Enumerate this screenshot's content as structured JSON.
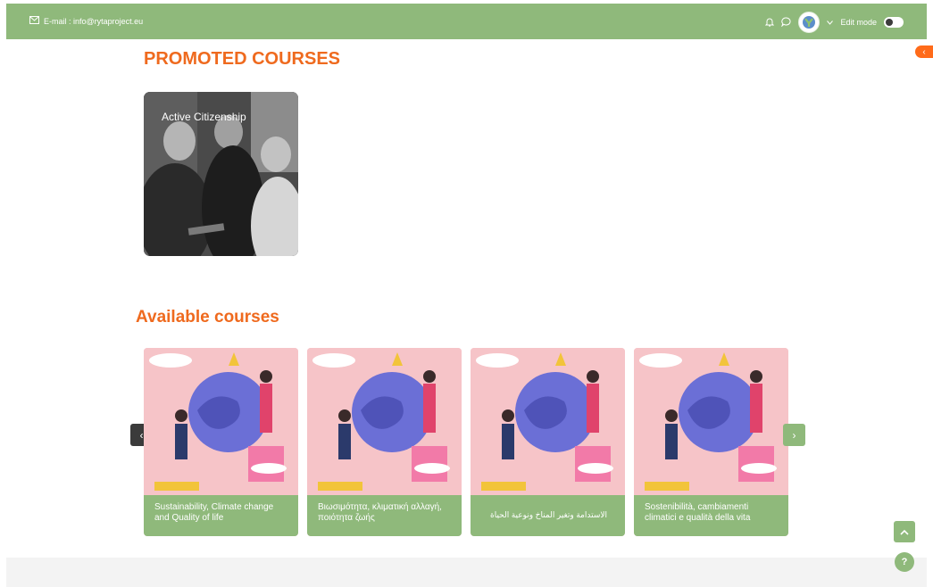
{
  "topbar": {
    "email_text": "E-mail : info@rytaproject.eu",
    "edit_mode_label": "Edit mode"
  },
  "promoted": {
    "heading": "PROMOTED COURSES",
    "courses": [
      {
        "title": "Active Citizenship"
      }
    ]
  },
  "available": {
    "heading": "Available courses",
    "courses": [
      {
        "title": "Sustainability, Climate change and Quality of life"
      },
      {
        "title": "Βιωσιμότητα, κλιματική αλλαγή, ποιότητα ζωής"
      },
      {
        "title": "الاستدامة وتغير المناخ ونوعية الحياة"
      },
      {
        "title": "Sostenibilità, cambiamenti climatici e qualità della vita"
      }
    ]
  },
  "controls": {
    "prev_icon": "chevron-left-icon",
    "next_icon": "chevron-right-icon",
    "back_to_top_icon": "chevron-up-icon",
    "help_icon": "question-mark-icon",
    "drawer_icon": "chevron-left-icon"
  },
  "colors": {
    "brand_green": "#8fb97b",
    "accent_orange": "#ef6a1e",
    "card_pink": "#f6c4c8",
    "dark_button": "#3b3b3b"
  }
}
